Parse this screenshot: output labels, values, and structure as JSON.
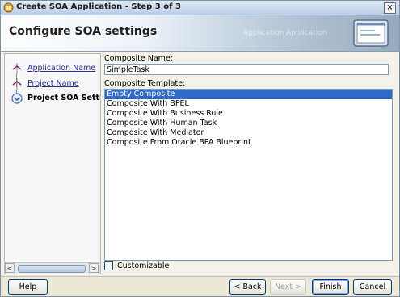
{
  "window": {
    "title": "Create SOA Application - Step 3 of 3",
    "close_symbol": "×"
  },
  "header": {
    "title": "Configure SOA settings",
    "watermark": "Application Application"
  },
  "steps": [
    {
      "label": "Application Name",
      "state": "done"
    },
    {
      "label": "Project Name",
      "state": "done"
    },
    {
      "label": "Project SOA Settings",
      "state": "current"
    }
  ],
  "scrollbar": {
    "left_arrow": "<",
    "right_arrow": ">"
  },
  "composite_name": {
    "label": "Composite Name:",
    "value": "SimpleTask"
  },
  "composite_template": {
    "label": "Composite Template:",
    "items": [
      "Empty Composite",
      "Composite With BPEL",
      "Composite With Business Rule",
      "Composite With Human Task",
      "Composite With Mediator",
      "Composite From Oracle BPA Blueprint"
    ],
    "selected_index": 0
  },
  "customizable": {
    "label": "Customizable",
    "checked": false
  },
  "buttons": {
    "help": "Help",
    "back": "< Back",
    "next": "Next >",
    "finish": "Finish",
    "cancel": "Cancel"
  },
  "colors": {
    "selection": "#316ac5",
    "link": "#2b2e9c",
    "title_bar": "#b9cde6"
  }
}
